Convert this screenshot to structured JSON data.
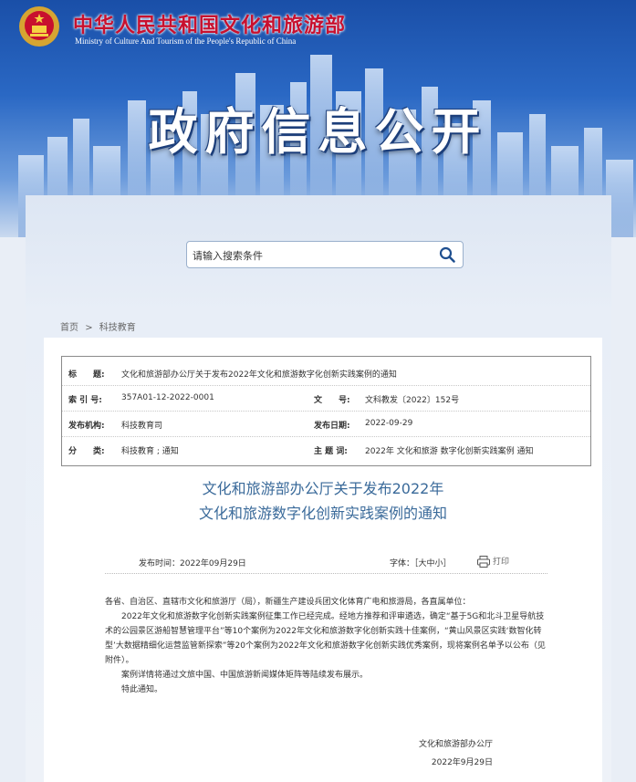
{
  "header": {
    "site_name_cn": "中华人民共和国文化和旅游部",
    "site_name_en": "Ministry of Culture And Tourism of the People's Republic of China",
    "hero_title": "政府信息公开"
  },
  "search": {
    "placeholder": "请输入搜索条件"
  },
  "breadcrumb": {
    "home": "首页",
    "separator": ">",
    "current": "科技教育"
  },
  "meta": {
    "title_label": "标　　题:",
    "title_value": "文化和旅游部办公厅关于发布2022年文化和旅游数字化创新实践案例的通知",
    "index_label": "索 引 号:",
    "index_value": "357A01-12-2022-0001",
    "docno_label": "文　　号:",
    "docno_value": "文科教发〔2022〕152号",
    "org_label": "发布机构:",
    "org_value": "科技教育司",
    "date_label": "发布日期:",
    "date_value": "2022-09-29",
    "category_label": "分　　类:",
    "category_value": "科技教育 ;  通知",
    "subject_label": "主 题 词:",
    "subject_value": "2022年 文化和旅游 数字化创新实践案例 通知"
  },
  "document": {
    "title_line1": "文化和旅游部办公厅关于发布2022年",
    "title_line2": "文化和旅游数字化创新实践案例的通知",
    "pub_time": "发布时间：2022年09月29日",
    "font_size": "字体：［大中小］",
    "print_label": "打印",
    "salutation": "各省、自治区、直辖市文化和旅游厅（局），新疆生产建设兵团文化体育广电和旅游局，各直属单位：",
    "para1": "2022年文化和旅游数字化创新实践案例征集工作已经完成。经地方推荐和评审遴选，确定“基于5G和北斗卫星导航技术的公园景区游船智慧管理平台”等10个案例为2022年文化和旅游数字化创新实践十佳案例，“黄山风景区实践‘数智化转型’大数据精细化运营监管新探索”等20个案例为2022年文化和旅游数字化创新实践优秀案例，现将案例名单予以公布（见附件）。",
    "para2": "案例详情将通过文旅中国、中国旅游新闻媒体矩阵等陆续发布展示。",
    "para3": "特此通知。",
    "signature": "文化和旅游部办公厅",
    "sign_date": "2022年9月29日"
  },
  "colors": {
    "accent_red": "#c8102e",
    "title_blue": "#3a6a9a",
    "banner_blue": "#1a4fa8"
  }
}
